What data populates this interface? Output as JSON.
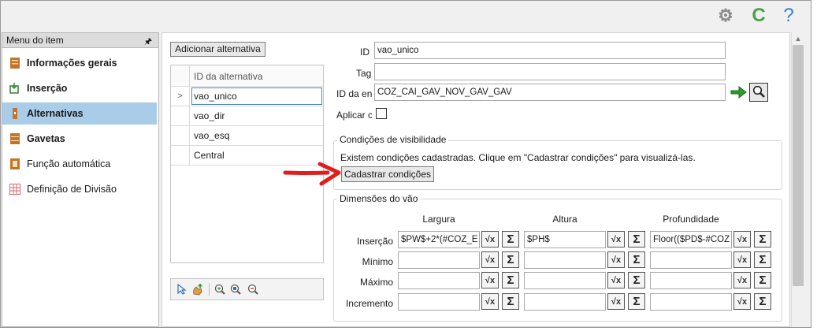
{
  "colors": {
    "gear": "#8a8a8a",
    "refresh": "#4aa14a",
    "help": "#2f7fd1",
    "active_item": "#a9cde9",
    "arrow": "#e01e1e",
    "go_arrow": "#2e9b2e"
  },
  "toolbar": {
    "gear_icon": "⚙",
    "refresh_icon": "C",
    "help_icon": "?"
  },
  "sidebar": {
    "title": "Menu do item",
    "pin_icon": "🖈",
    "items": [
      {
        "label": "Informações gerais",
        "icon": "info-icon",
        "bold": true
      },
      {
        "label": "Inserção",
        "icon": "insert-icon",
        "bold": true
      },
      {
        "label": "Alternativas",
        "icon": "alternatives-icon",
        "bold": true,
        "active": true
      },
      {
        "label": "Gavetas",
        "icon": "drawers-icon",
        "bold": true
      },
      {
        "label": "Função automática",
        "icon": "auto-function-icon",
        "bold": false
      },
      {
        "label": "Definição de Divisão",
        "icon": "division-grid-icon",
        "bold": false
      }
    ]
  },
  "alternatives": {
    "add_button": "Adicionar alternativa",
    "column_header": "ID da alternativa",
    "selected_marker": ">",
    "rows": [
      "vao_unico",
      "vao_dir",
      "vao_esq",
      "Central"
    ]
  },
  "form": {
    "id_label": "ID",
    "id_value": "vao_unico",
    "tag_label": "Tag",
    "tag_value": "",
    "entity_label": "ID da en",
    "entity_value": "COZ_CAI_GAV_NOV_GAV_GAV",
    "apply_label": "Aplicar c"
  },
  "visibility": {
    "legend": "Condições de visibilidade",
    "message": "Existem condições cadastradas. Clique em \"Cadastrar condições\" para visualizá-las.",
    "button": "Cadastrar condições"
  },
  "dimensions": {
    "legend": "Dimensões do vão",
    "columns": [
      "Largura",
      "Altura",
      "Profundidade"
    ],
    "rows": [
      {
        "label": "Inserção",
        "values": [
          "$PW$+2*(#COZ_E",
          "$PH$",
          "Floor(($PD$-#COZ"
        ]
      },
      {
        "label": "Mínimo",
        "values": [
          "",
          "",
          ""
        ]
      },
      {
        "label": "Máximo",
        "values": [
          "",
          "",
          ""
        ]
      },
      {
        "label": "Incremento",
        "values": [
          "",
          "",
          ""
        ]
      }
    ],
    "fx_label": "√x",
    "sum_label": "Σ"
  }
}
